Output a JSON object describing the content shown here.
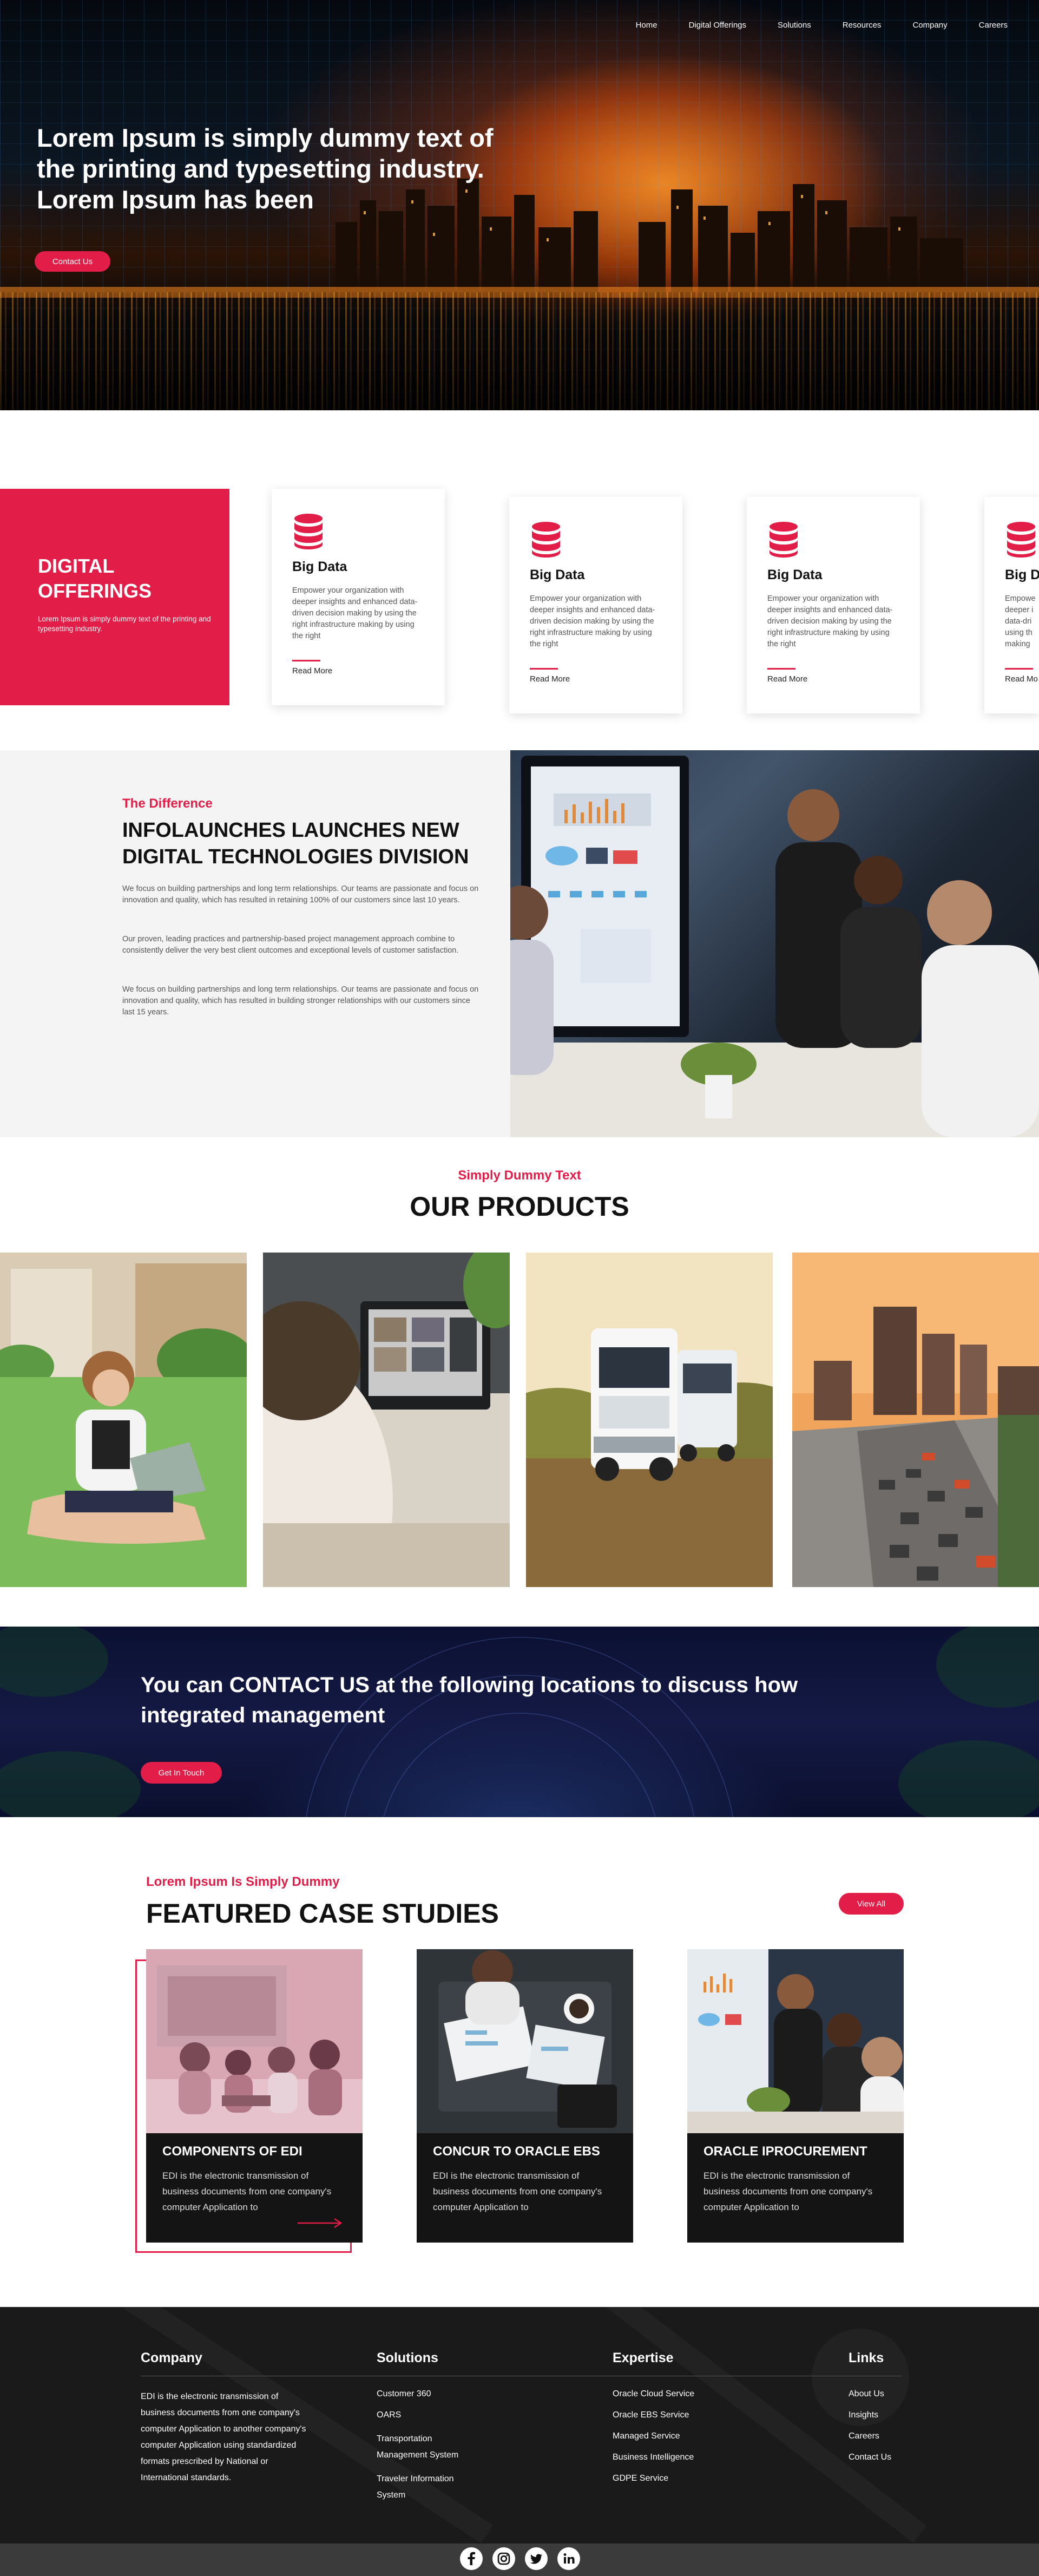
{
  "nav": {
    "items": [
      "Home",
      "Digital Offerings",
      "Solutions",
      "Resources",
      "Company",
      "Careers"
    ]
  },
  "hero": {
    "title": "Lorem Ipsum is simply dummy text of the printing and typesetting industry. Lorem Ipsum has been",
    "button": "Contact Us"
  },
  "offerings": {
    "title": "DIGITAL OFFERINGS",
    "text": "Lorem Ipsum is simply dummy text of the printing and typesetting industry.",
    "cards": [
      {
        "title": "Big Data",
        "text": "Empower your organization with deeper insights and enhanced data-driven decision making by using the right infrastructure making by using the right",
        "more": "Read More"
      },
      {
        "title": "Big Data",
        "text": "Empower your organization with deeper insights and enhanced data-driven decision making by using the right infrastructure making by using the right",
        "more": "Read More"
      },
      {
        "title": "Big Data",
        "text": "Empower your organization with deeper insights and enhanced data-driven decision making by using the right infrastructure making by using the right",
        "more": "Read More"
      },
      {
        "title": "Big Da",
        "text": "Empowe deeper i data-dri using th making",
        "more": "Read Mo"
      }
    ]
  },
  "difference": {
    "subtitle": "The Difference",
    "title": "INFOLAUNCHES LAUNCHES NEW DIGITAL TECHNOLOGIES DIVISION",
    "p1": "We focus on building partnerships and long term relationships. Our teams are passionate and focus on innovation and quality, which has resulted in retaining 100% of our customers since last 10 years.",
    "p2": "Our proven, leading practices and partnership-based project management approach combine to consistently deliver the very best client outcomes and exceptional levels of customer satisfaction.",
    "p3": "We focus on building partnerships and long term relationships. Our teams are passionate and focus on innovation and quality, which has resulted in building stronger relationships with our customers since last 15 years."
  },
  "products": {
    "subtitle": "Simply Dummy Text",
    "title": "OUR PRODUCTS"
  },
  "contact_band": {
    "title": "You can CONTACT US at the following locations to discuss how integrated management",
    "button": "Get In Touch"
  },
  "case_studies": {
    "subtitle": "Lorem Ipsum Is Simply Dummy",
    "title": "FEATURED CASE STUDIES",
    "view_all": "View All",
    "cards": [
      {
        "title": "COMPONENTS OF EDI",
        "text": "EDI is the electronic transmission of business documents from one company's computer Application to"
      },
      {
        "title": "CONCUR TO ORACLE EBS",
        "text": "EDI is the electronic transmission of business documents from one company's computer Application to"
      },
      {
        "title": "ORACLE IPROCUREMENT",
        "text": "EDI is the electronic transmission of business documents from one company's computer Application to"
      }
    ]
  },
  "footer": {
    "company": {
      "title": "Company",
      "text": "EDI is the electronic transmission of business documents from one company's computer Application to another company's computer Application using standardized formats prescribed by National or International standards."
    },
    "solutions": {
      "title": "Solutions",
      "items": [
        "Customer 360",
        "OARS",
        "Transportation Management System",
        "Traveler Information System"
      ]
    },
    "expertise": {
      "title": "Expertise",
      "items": [
        "Oracle Cloud Service",
        "Oracle EBS Service",
        "Managed Service",
        "Business Intelligence",
        "GDPE Service"
      ]
    },
    "links": {
      "title": "Links",
      "items": [
        "About Us",
        "Insights",
        "Careers",
        "Contact Us"
      ]
    },
    "social": [
      "facebook-icon",
      "instagram-icon",
      "twitter-icon",
      "linkedin-icon"
    ]
  },
  "colors": {
    "accent": "#e11d48",
    "dark": "#141414",
    "band": "#0b1032"
  }
}
